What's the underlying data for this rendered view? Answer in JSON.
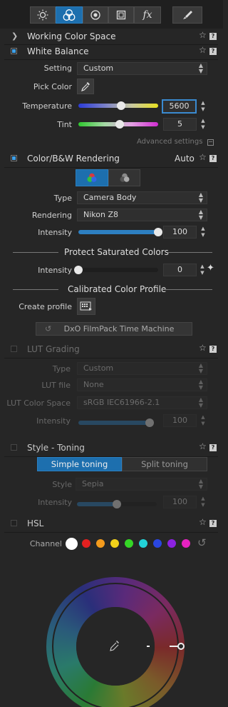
{
  "toolbar": {
    "tabs": [
      {
        "icon": "brightness-icon"
      },
      {
        "icon": "color-circles-icon",
        "active": true
      },
      {
        "icon": "detail-lens-icon"
      },
      {
        "icon": "geometry-icon"
      },
      {
        "label": "fx"
      },
      {
        "icon": "local-adjust-brush-icon"
      }
    ]
  },
  "working_color_space": {
    "title": "Working Color Space"
  },
  "white_balance": {
    "title": "White Balance",
    "setting_label": "Setting",
    "setting_value": "Custom",
    "pick_color_label": "Pick Color",
    "temperature_label": "Temperature",
    "temperature_value": "5600",
    "temperature_position": 0.54,
    "tint_label": "Tint",
    "tint_value": "5",
    "tint_position": 0.52,
    "advanced_label": "Advanced settings"
  },
  "color_bw": {
    "title": "Color/B&W Rendering",
    "mode": "Auto",
    "type_label": "Type",
    "type_value": "Camera Body",
    "rendering_label": "Rendering",
    "rendering_value": "Nikon Z8",
    "intensity_label": "Intensity",
    "intensity_value": "100",
    "intensity_position": 1.0,
    "protect_title": "Protect Saturated Colors",
    "protect_intensity_label": "Intensity",
    "protect_intensity_value": "0",
    "protect_position": 0.0,
    "calibrated_title": "Calibrated Color Profile",
    "create_profile_label": "Create profile",
    "filmpack_button": "DxO FilmPack Time Machine"
  },
  "lut": {
    "title": "LUT Grading",
    "type_label": "Type",
    "type_value": "Custom",
    "lut_file_label": "LUT file",
    "lut_file_value": "None",
    "color_space_label": "LUT Color Space",
    "color_space_value": "sRGB IEC61966-2.1",
    "intensity_label": "Intensity",
    "intensity_value": "100",
    "intensity_position": 1.0
  },
  "style_toning": {
    "title": "Style - Toning",
    "tab_simple": "Simple toning",
    "tab_split": "Split toning",
    "style_label": "Style",
    "style_value": "Sepia",
    "intensity_label": "Intensity",
    "intensity_value": "100",
    "intensity_position": 0.5
  },
  "hsl": {
    "title": "HSL",
    "channel_label": "Channel",
    "channels": [
      "#ffffff",
      "#e32020",
      "#f39a1c",
      "#f2d11a",
      "#35d626",
      "#22d3d8",
      "#2a46e0",
      "#8b22e0",
      "#e622c0"
    ]
  },
  "colors": {
    "accent": "#3ea0e8",
    "section_bg": "#262626",
    "toolbar_bg": "#1f1f1f",
    "active_tab": "#1d6fae"
  }
}
